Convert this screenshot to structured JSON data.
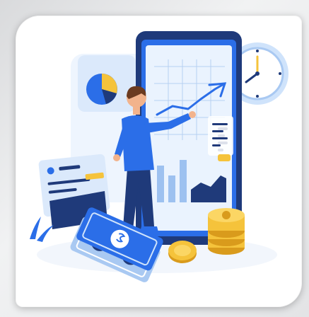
{
  "illustration": {
    "subject": "person-drawing-on-tablet-chart",
    "colors": {
      "primary_blue": "#2b6ee8",
      "dark_navy": "#1f3a7a",
      "light_blue": "#cfe3fb",
      "gold": "#f5c33b",
      "gold_dark": "#d99b1c",
      "skin": "#f2b38c",
      "hair": "#6b3b20"
    },
    "icons": [
      "pie-chart-icon",
      "clock-icon",
      "wallet-icon",
      "banknote-icon",
      "coin-stack-icon",
      "dollar-icon"
    ]
  }
}
